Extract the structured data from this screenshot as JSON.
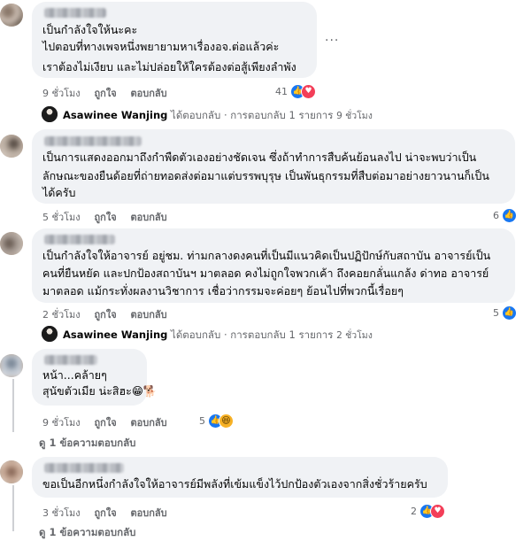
{
  "comments": [
    {
      "lines": [
        "เป็นกำลังใจให้นะคะ",
        "ไปตอบที่ทางเพจหนึ่งพยายามหาเรื่องอจ.ต่อแล้วค่ะ",
        "เราต้องไม่เงียบ และไม่ปล่อยให้ใครต้องต่อสู้เพียงลำพัง"
      ],
      "time": "9 ชั่วโมง",
      "like": "ถูกใจ",
      "reply": "ตอบกลับ",
      "reaction_count": "41",
      "reactions": [
        "like-icon",
        "love-icon"
      ],
      "more": "···"
    },
    {
      "lines": [
        "เป็นการแสดงออกมาถึงกำพืดตัวเองอย่างชัดเจน ซึ่งถ้าทำการสืบค้นย้อนลงไป น่าจะพบว่าเป็น",
        "ลักษณะของยืนด้อยที่ถ่ายทอดส่งต่อมาแต่บรรพบุรุษ เป็นพันธุกรรมที่สืบต่อมาอย่างยาวนานก็เป็น",
        "ได้ครับ"
      ],
      "time": "5 ชั่วโมง",
      "like": "ถูกใจ",
      "reply": "ตอบกลับ",
      "reaction_count": "6",
      "reactions": [
        "like-icon"
      ]
    },
    {
      "lines": [
        "เป็นกำลังใจให้อาจารย์ อยู่ชม. ท่ามกลางดงคนที่เป็นมีแนวคิดเป็นปฏิปักษ์กับสถาบัน อาจารย์เป็น",
        "คนที่ยืนหยัด และปกป้องสถาบันฯ มาตลอด คงไม่ถูกใจพวกเค้า ถึงคอยกลั่นแกล้ง ด่าทอ อาจารย์",
        "มาตลอด แม้กระทั่งผลงานวิชาการ เชื่อว่ากรรมจะค่อยๆ ย้อนไปที่พวกนี้เรื่อยๆ"
      ],
      "time": "2 ชั่วโมง",
      "like": "ถูกใจ",
      "reply": "ตอบกลับ",
      "reaction_count": "5",
      "reactions": [
        "like-icon"
      ]
    },
    {
      "lines": [
        "หน้า...คล้ายๆ",
        "สุนัขตัวเมีย น่ะสิฮะ😁🐕"
      ],
      "time": "9 ชั่วโมง",
      "like": "ถูกใจ",
      "reply": "ตอบกลับ",
      "reaction_count": "5",
      "reactions": [
        "like-icon",
        "haha-icon"
      ],
      "view_replies": "ดู 1 ข้อความตอบกลับ"
    },
    {
      "lines": [
        "ขอเป็นอีกหนึ่งกำลังใจให้อาจารย์มีพลังที่เข้มแข็งไว้ปกป้องตัวเองจากสิ่งชั่วร้ายครับ"
      ],
      "time": "3 ชั่วโมง",
      "like": "ถูกใจ",
      "reply": "ตอบกลับ",
      "reaction_count": "2",
      "reactions": [
        "like-icon",
        "love-icon"
      ],
      "view_replies": "ดู 1 ข้อความตอบกลับ"
    }
  ],
  "replies": [
    {
      "author": "Asawinee Wanjing",
      "action": "ได้ตอบกลับ · การตอบกลับ 1 รายการ",
      "time": "9 ชั่วโมง"
    },
    {
      "author": "Asawinee Wanjing",
      "action": "ได้ตอบกลับ · การตอบกลับ 1 รายการ",
      "time": "2 ชั่วโมง"
    }
  ],
  "colors": {
    "bubble": "#f0f2f5",
    "meta": "#65676b",
    "like_blue": "#1877f2",
    "love_red": "#f33e58",
    "haha_yellow": "#f7b125"
  }
}
